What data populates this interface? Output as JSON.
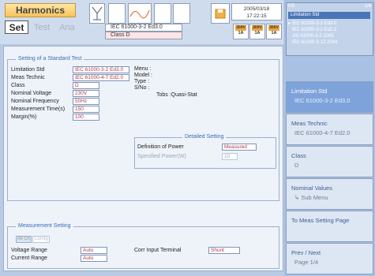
{
  "header": {
    "title": "Harmonics",
    "modes": [
      "Set",
      "Test",
      "Ana"
    ],
    "standard_line1": "IEC 61000-3-2 Ed3.0",
    "standard_line2": "Class D",
    "date": "2005/03/18",
    "time": "17:22:15",
    "ranges": [
      {
        "top": "300V",
        "bottom": "1A"
      },
      {
        "top": "300V",
        "bottom": "1A"
      },
      {
        "top": "300V",
        "bottom": "1A"
      }
    ]
  },
  "standard_test": {
    "title": "Setting of a Standard Test",
    "limitation_std": {
      "label": "Limitation Std",
      "value": "IEC 61000-3-2 Ed3.0"
    },
    "meas_technic": {
      "label": "Meas Technic",
      "value": "IEC 61000-4-7 Ed2.0"
    },
    "class": {
      "label": "Class",
      "value": "D"
    },
    "nominal_voltage": {
      "label": "Nominal Voltage",
      "value": "230V"
    },
    "nominal_frequency": {
      "label": "Nominal Frequency",
      "value": "50Hz"
    },
    "measurement_time": {
      "label": "Measurement Time(s)",
      "value": "150"
    },
    "margin": {
      "label": "Margin(%)",
      "value": "100"
    },
    "info_labels": [
      "Menu :",
      "Model :",
      "Type :",
      "S/No :"
    ],
    "tobs": "Tobs :Quasi-Stat"
  },
  "detailed": {
    "title": "Detailed Setting",
    "definition_power_label": "Definition of Power",
    "definition_power_value": "Measured",
    "specified_power_label": "Specified Power(W)",
    "specified_power_value": "10"
  },
  "measurement": {
    "title": "Measurement Setting",
    "tabs": [
      "All Ch",
      "Config"
    ],
    "voltage_range_label": "Voltage Range",
    "voltage_range_value": "Auto",
    "current_range_label": "Current Range",
    "current_range_value": "Auto",
    "corr_input_label": "Corr Input Terminal",
    "corr_input_value": "Shunt"
  },
  "std_list": {
    "label": "HS",
    "page": "1/4",
    "selected": "Limitation Std",
    "items": [
      "IEC 61000-3-2 Ed3.0",
      "IEC 61000-3-2 Ed2.2",
      "JIS 61000-3-2 2005",
      "IEC 61000-3-12 2004"
    ]
  },
  "softkeys": [
    {
      "label": "Limitation Std",
      "sub": "IEC 61000-3-2 Ed3.0",
      "active": true
    },
    {
      "label": "Meas Technic",
      "sub": "IEC 61000-4-7 Ed2.0",
      "active": false
    },
    {
      "label": "Class",
      "sub": "D",
      "active": false
    },
    {
      "label": "Nominal Values",
      "sub": "↳ Sub Menu",
      "active": false
    },
    {
      "label": "To Meas Setting Page",
      "sub": "",
      "active": false
    },
    {
      "label": "Prev / Next",
      "sub": "Page 1/4",
      "active": false
    }
  ]
}
